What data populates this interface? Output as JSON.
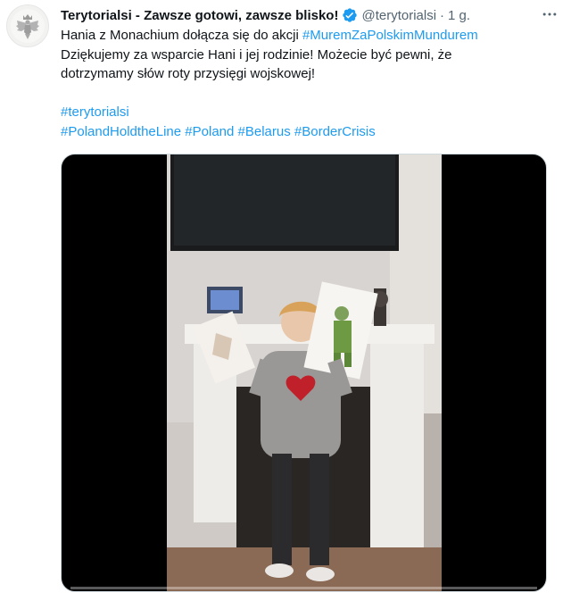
{
  "tweet": {
    "author": {
      "display_name": "Terytorialsi - Zawsze gotowi, zawsze blisko!",
      "handle": "@terytorialsi",
      "separator": "·",
      "time": "1 g.",
      "verified": true,
      "avatar_icon": "white-eagle-emblem-icon"
    },
    "text": {
      "line1_prefix": "Hania z Monachium dołącza się do akcji ",
      "line1_hashtag": "#MuremZaPolskimMundurem",
      "line2": "Dziękujemy za wsparcie Hani i jej rodzinie! Możecie być pewni, że",
      "line3": "dotrzymamy słów roty przysięgi wojskowej!",
      "hashtag_line1": "#terytorialsi",
      "hashtags_line2": [
        "#PolandHoldtheLine",
        "#Poland",
        "#Belarus",
        "#BorderCrisis"
      ]
    },
    "media": {
      "type": "video",
      "progress": 0.0
    }
  },
  "colors": {
    "link": "#1d9bf0",
    "secondary": "#536471",
    "verified": "#1d9bf0",
    "text": "#0f1419"
  }
}
